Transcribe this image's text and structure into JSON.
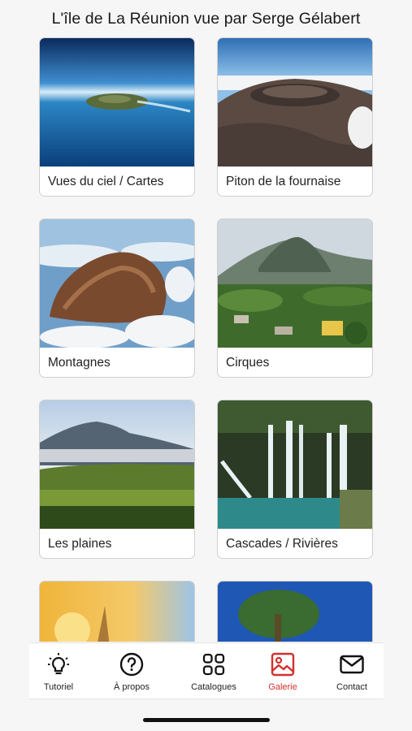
{
  "header": {
    "title": "L'île de La Réunion vue par Serge Gélabert"
  },
  "gallery": {
    "items": [
      {
        "label": "Vues du ciel / Cartes"
      },
      {
        "label": "Piton de la fournaise"
      },
      {
        "label": "Montagnes"
      },
      {
        "label": "Cirques"
      },
      {
        "label": "Les plaines"
      },
      {
        "label": "Cascades / Rivières"
      },
      {
        "label": ""
      },
      {
        "label": ""
      }
    ]
  },
  "tabbar": {
    "tabs": [
      {
        "label": "Tutoriel",
        "icon": "lightbulb-icon"
      },
      {
        "label": "À propos",
        "icon": "question-circle-icon"
      },
      {
        "label": "Catalogues",
        "icon": "grid-icon"
      },
      {
        "label": "Galerie",
        "icon": "image-icon",
        "active": true
      },
      {
        "label": "Contact",
        "icon": "envelope-icon"
      }
    ],
    "active_color": "#d32f2f"
  }
}
